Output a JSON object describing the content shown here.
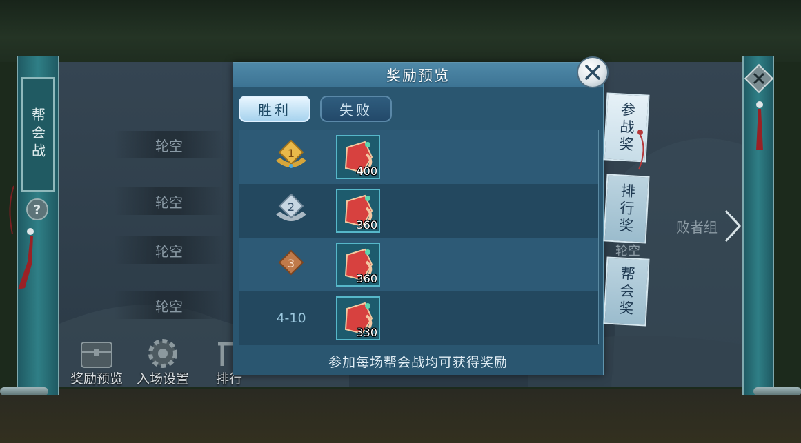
{
  "side_title": "帮会战",
  "help_label": "?",
  "bracket_slots": [
    "轮空",
    "轮空",
    "轮空",
    "轮空"
  ],
  "loser_group": {
    "label": "败者组",
    "slot": "轮空"
  },
  "bottom_buttons": [
    {
      "label": "奖励预览",
      "icon": "treasure-chest-icon"
    },
    {
      "label": "入场设置",
      "icon": "gear-icon"
    },
    {
      "label": "排行",
      "icon": "ranking-icon"
    }
  ],
  "modal": {
    "title": "奖励预览",
    "tabs": [
      {
        "label": "胜利",
        "active": true
      },
      {
        "label": "失败",
        "active": false
      }
    ],
    "rows": [
      {
        "rank": "1",
        "rank_icon": "gold-medal-icon",
        "count": "400"
      },
      {
        "rank": "2",
        "rank_icon": "silver-medal-icon",
        "count": "360"
      },
      {
        "rank": "3",
        "rank_icon": "bronze-medal-icon",
        "count": "360"
      },
      {
        "rank": "4-10",
        "rank_icon": null,
        "count": "330"
      }
    ],
    "footer": "参加每场帮会战均可获得奖励"
  },
  "side_tabs": [
    {
      "label": "参战奖",
      "active": true
    },
    {
      "label": "排行奖",
      "active": false
    },
    {
      "label": "帮会奖",
      "active": false
    }
  ],
  "colors": {
    "modal_bg": "#2a5670",
    "tab_active": "#a7d3ee",
    "item_border": "#56b7c9"
  }
}
